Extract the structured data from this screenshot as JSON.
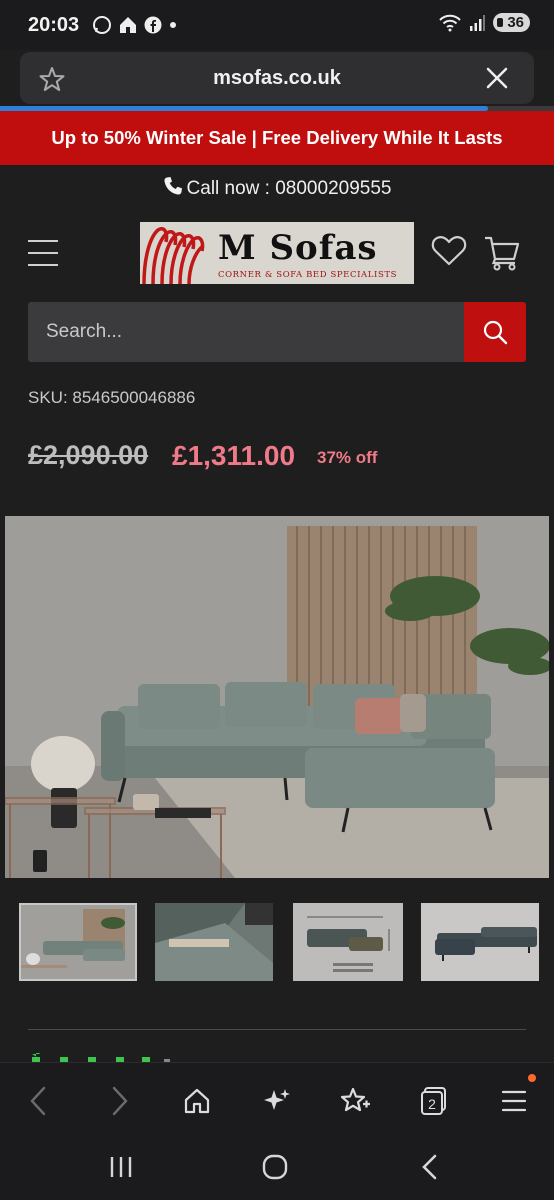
{
  "status_bar": {
    "time": "20:03",
    "battery": "36"
  },
  "browser": {
    "url": "msofas.co.uk",
    "load_progress": 0.88,
    "tab_count": "2"
  },
  "promo": {
    "text": "Up to 50% Winter Sale | Free Delivery While It Lasts"
  },
  "header": {
    "call_text": "Call now : 08000209555",
    "logo_text": "M Sofas",
    "logo_tagline": "CORNER & SOFA BED SPECIALISTS"
  },
  "search": {
    "placeholder": "Search..."
  },
  "product": {
    "sku": "SKU: 8546500046886",
    "old_price": "£2,090.00",
    "new_price": "£1,311.00",
    "discount": "37% off"
  },
  "colors": {
    "accent_red": "#c00d0d",
    "price_pink": "#f07a88",
    "progress_blue": "#2f7fd8"
  },
  "icons": [
    "star-icon",
    "close-icon",
    "phone-icon",
    "menu-icon",
    "heart-icon",
    "cart-icon",
    "search-icon",
    "back-icon",
    "forward-icon",
    "home-icon",
    "sparkle-icon",
    "bookmark-star-icon",
    "tabs-icon",
    "menu-icon"
  ]
}
